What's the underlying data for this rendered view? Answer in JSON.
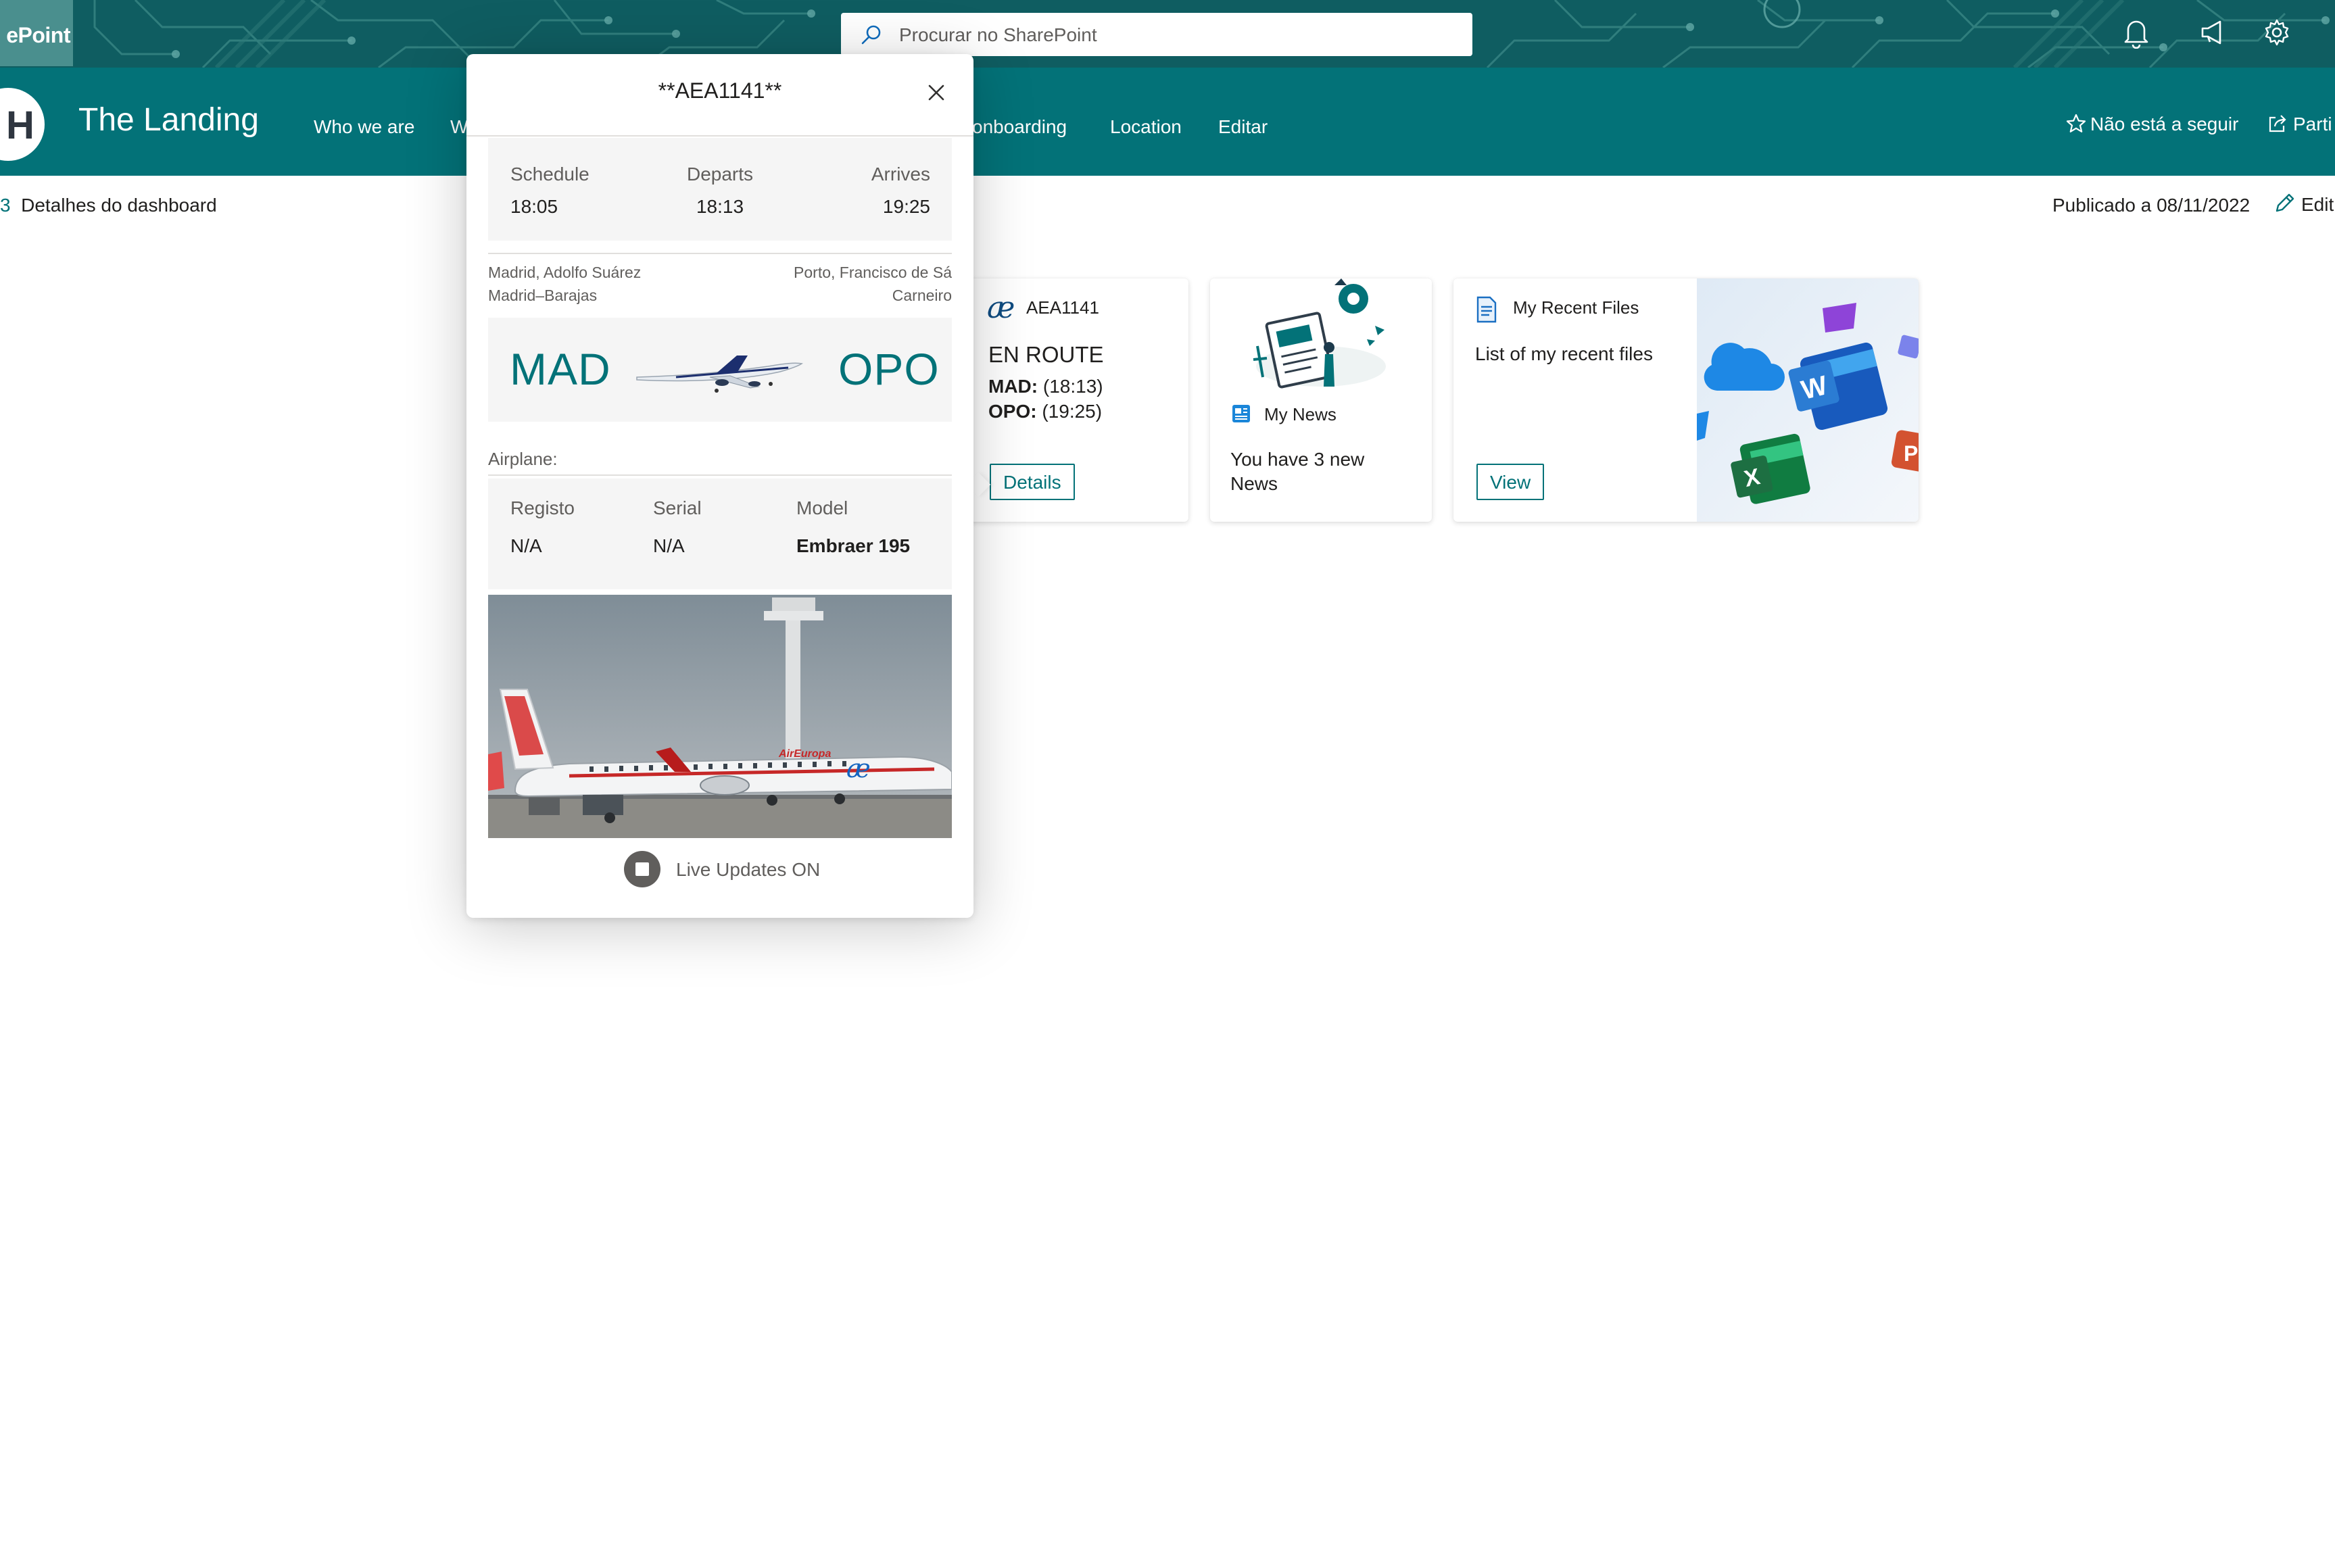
{
  "suite_bar": {
    "app_name": "ePoint",
    "search_placeholder": "Procurar no SharePoint"
  },
  "site": {
    "logo_letter": "H",
    "title": "The Landing",
    "nav": [
      "Who we are",
      "W",
      "onboarding",
      "Location",
      "Editar"
    ],
    "follow_label": "Não está a seguir",
    "share_label": "Parti"
  },
  "command_bar": {
    "breadcrumb": "Detalhes do dashboard",
    "published": "Publicado a 08/11/2022",
    "edit_label": "Edit"
  },
  "flight_card": {
    "airline_logo": "æ",
    "flight_code": "AEA1141",
    "status": "EN ROUTE",
    "origin_code": "MAD:",
    "origin_time": "(18:13)",
    "dest_code": "OPO:",
    "dest_time": "(19:25)",
    "button": "Details"
  },
  "news_card": {
    "title": "My News",
    "text": "You have 3 new News"
  },
  "files_card": {
    "title": "My Recent Files",
    "text": "List of my recent files",
    "button": "View"
  },
  "popup": {
    "title": "**AEA1141**",
    "schedule_label": "Schedule",
    "schedule_value": "18:05",
    "departs_label": "Departs",
    "departs_value": "18:13",
    "arrives_label": "Arrives",
    "arrives_value": "19:25",
    "origin_airport_line1": "Madrid, Adolfo Suárez",
    "origin_airport_line2": "Madrid–Barajas",
    "dest_airport_line1": "Porto, Francisco de Sá",
    "dest_airport_line2": "Carneiro",
    "origin_code": "MAD",
    "dest_code": "OPO",
    "airplane_label": "Airplane:",
    "registo_label": "Registo",
    "registo_value": "N/A",
    "serial_label": "Serial",
    "serial_value": "N/A",
    "model_label": "Model",
    "model_value": "Embraer 195",
    "photo_livery_text": "AirEuropa",
    "live_updates": "Live Updates ON"
  },
  "colors": {
    "brand_teal": "#037278",
    "suite_dark": "#0f5d61"
  }
}
